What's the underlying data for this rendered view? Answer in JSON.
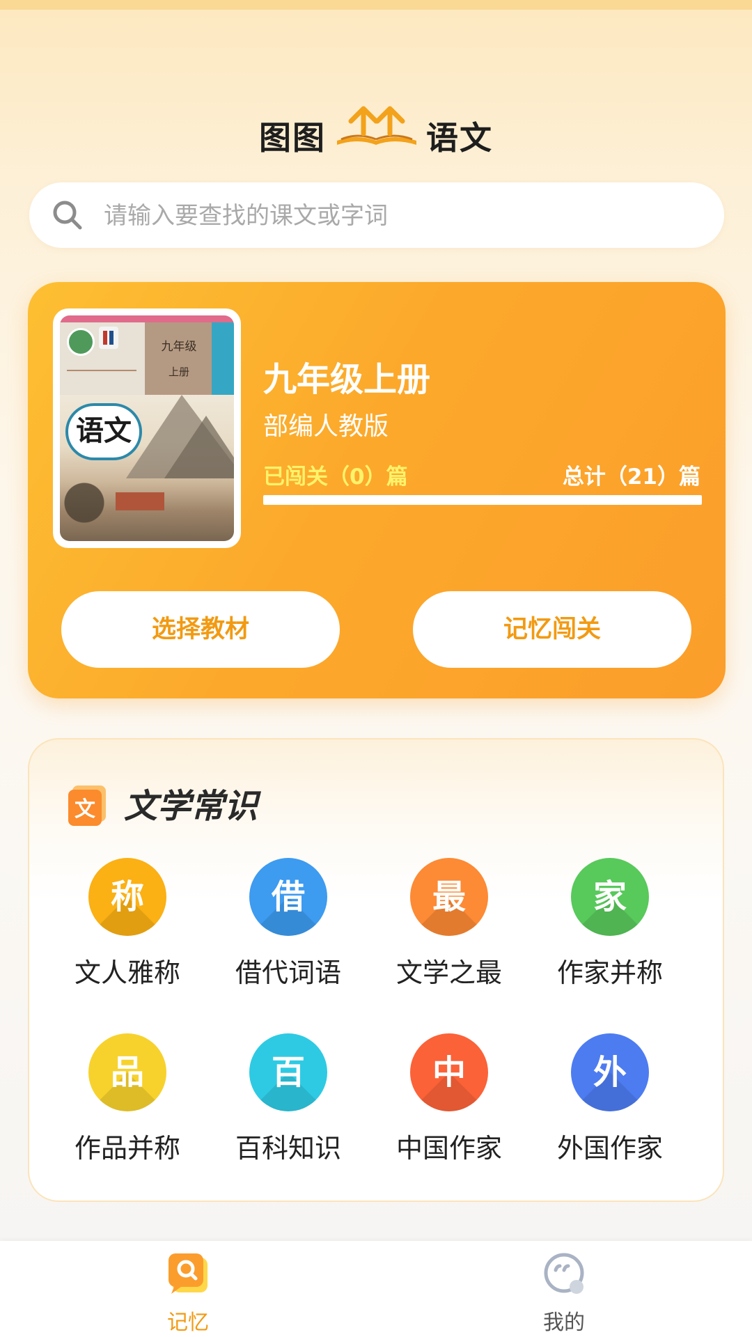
{
  "header": {
    "logo_left": "图图",
    "logo_right": "语文"
  },
  "search": {
    "placeholder": "请输入要查找的课文或字词"
  },
  "book": {
    "cover_title": "语文",
    "cover_grade": "九年级",
    "cover_volume": "上册",
    "title": "九年级上册",
    "edition": "部编人教版",
    "completed_label": "已闯关（0）篇",
    "total_label": "总计（21）篇",
    "progress_fraction": 0,
    "select_button": "选择教材",
    "challenge_button": "记忆闯关"
  },
  "knowledge": {
    "title": "文学常识",
    "header_icon_char": "文",
    "items": [
      {
        "char": "称",
        "label": "文人雅称",
        "color": "#fbb014"
      },
      {
        "char": "借",
        "label": "借代词语",
        "color": "#3d9bf0"
      },
      {
        "char": "最",
        "label": "文学之最",
        "color": "#fd8a34"
      },
      {
        "char": "家",
        "label": "作家并称",
        "color": "#58c95b"
      },
      {
        "char": "品",
        "label": "作品并称",
        "color": "#f7d22c"
      },
      {
        "char": "百",
        "label": "百科知识",
        "color": "#2ecae3"
      },
      {
        "char": "中",
        "label": "中国作家",
        "color": "#fb6238"
      },
      {
        "char": "外",
        "label": "外国作家",
        "color": "#4d7cf1"
      }
    ]
  },
  "nav": {
    "memory": "记忆",
    "mine": "我的"
  },
  "colors": {
    "accent": "#f29a12",
    "progress_done": "#fff36b"
  }
}
